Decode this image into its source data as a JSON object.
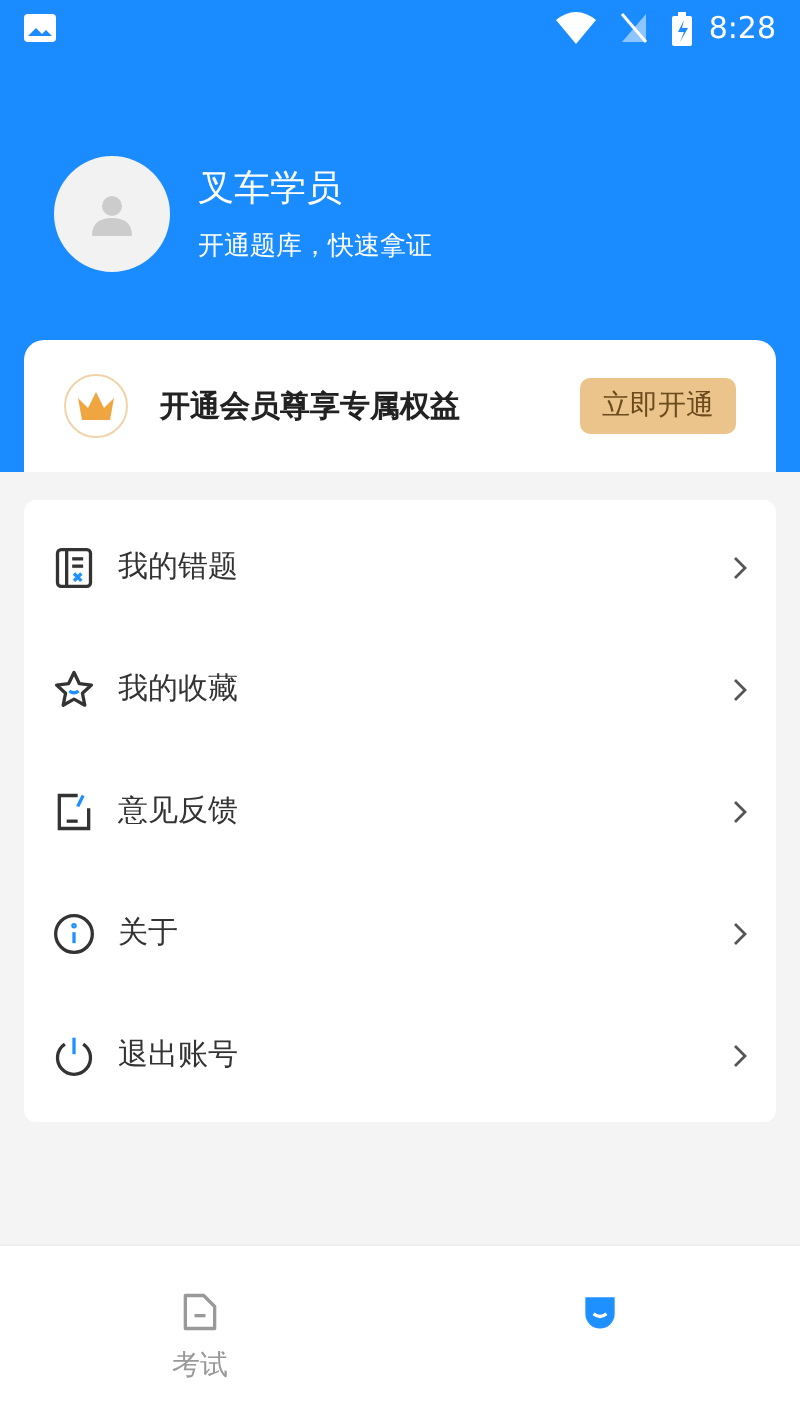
{
  "status_bar": {
    "time": "8:28"
  },
  "profile": {
    "name": "叉车学员",
    "subtitle": "开通题库，快速拿证"
  },
  "vip_card": {
    "text": "开通会员尊享专属权益",
    "button": "立即开通"
  },
  "menu": [
    {
      "kind": "mistakes",
      "label": "我的错题"
    },
    {
      "kind": "favorites",
      "label": "我的收藏"
    },
    {
      "kind": "feedback",
      "label": "意见反馈"
    },
    {
      "kind": "about",
      "label": "关于"
    },
    {
      "kind": "logout",
      "label": "退出账号"
    }
  ],
  "bottom_nav": [
    {
      "kind": "exam",
      "label": "考试",
      "selected": false
    },
    {
      "kind": "mine",
      "selected": true
    }
  ]
}
